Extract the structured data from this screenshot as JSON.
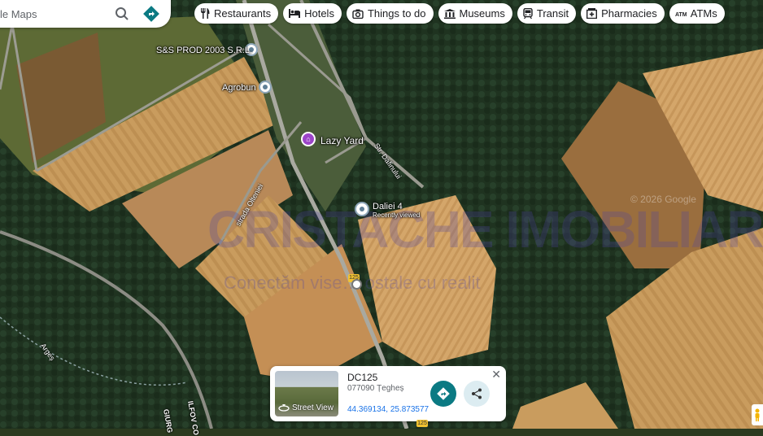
{
  "search": {
    "placeholder": "le Maps"
  },
  "chips": [
    {
      "label": "Restaurants",
      "icon": "fork-knife-icon"
    },
    {
      "label": "Hotels",
      "icon": "bed-icon"
    },
    {
      "label": "Things to do",
      "icon": "camera-icon"
    },
    {
      "label": "Museums",
      "icon": "museum-icon"
    },
    {
      "label": "Transit",
      "icon": "train-icon"
    },
    {
      "label": "Pharmacies",
      "icon": "pharmacy-icon"
    },
    {
      "label": "ATMs",
      "icon": "atm-icon"
    }
  ],
  "places": [
    {
      "name": "S&S PROD 2003 S.R.L."
    },
    {
      "name": "Agrobun"
    },
    {
      "name": "Lazy Yard"
    },
    {
      "name": "Daliei 4",
      "note": "Recently viewed"
    }
  ],
  "roads": {
    "dafinului": "Str. Dafinului",
    "olteniei": "strada Olteniei",
    "arges": "Argeș",
    "ilfov": "ILFOV CO",
    "giurg": "GIURG",
    "route": "125"
  },
  "watermark": {
    "brand": "CRISTACHE IMOBILIARE",
    "tagline": "Conectăm vise… ostale cu realit"
  },
  "copyright": "© 2026 Google",
  "card": {
    "title": "DC125",
    "subtitle": "077090 Țegheș",
    "coords": "44.369134, 25.873577",
    "street_view": "Street View",
    "route": "125"
  },
  "colors": {
    "accent": "#0b7a83",
    "link": "#1a73e8",
    "pin_purple": "#9c45c9"
  }
}
